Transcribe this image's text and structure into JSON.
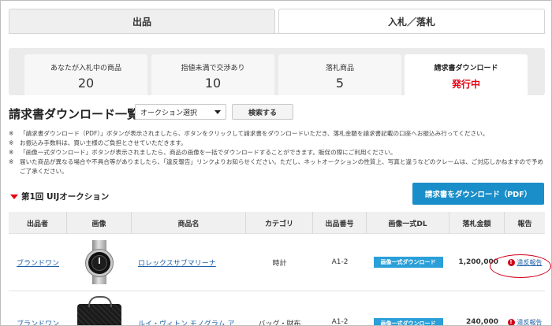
{
  "top_tabs": [
    {
      "label": "出品",
      "active": false
    },
    {
      "label": "入札／落札",
      "active": true
    }
  ],
  "status_cards": [
    {
      "label": "あなたが入札中の商品",
      "value": "20"
    },
    {
      "label": "指値未満で交渉あり",
      "value": "10"
    },
    {
      "label": "落札商品",
      "value": "5"
    },
    {
      "label": "請求書ダウンロード",
      "value": "発行中"
    }
  ],
  "page_title": "請求書ダウンロード一覧",
  "auction_select": {
    "value": "オークション選択"
  },
  "search_label": "検索する",
  "notes": [
    {
      "mark": "※",
      "text": "「請求書ダウンロード（PDF）」ボタンが表示されましたら、ボタンをクリックして請求書をダウンロードいただき、落札金額を請求書記載の口座へお振込み行ってください。"
    },
    {
      "mark": "※",
      "text": "お振込み手数料は、買い主様のご負担とさせていただきます。"
    },
    {
      "mark": "※",
      "text": "「画像一式ダウンロード」ボタンが表示されましたら、商品の画像を一括でダウンロードすることができます。販促の際にご利用ください。"
    },
    {
      "mark": "※",
      "text": "届いた商品が異なる場合や不具合等がありましたら、「違反報告」リンクよりお知らせください。ただし、ネットオークションの性質上、写真と違うなどのクレームは、ご対応しかねますので予めご了承ください。"
    }
  ],
  "auction_title": "第1回 UIJオークション",
  "download_pdf_label": "請求書をダウンロード（PDF）",
  "table": {
    "headers": [
      "出品者",
      "画像",
      "商品名",
      "カテゴリ",
      "出品番号",
      "画像一式DL",
      "落札金額",
      "報告"
    ],
    "rows": [
      {
        "seller": "ブランドワン",
        "image": "watch",
        "name": "ロレックスサブマリーナ",
        "category": "時計",
        "lot": "A1-2",
        "dl_label": "画像一式ダウンロード",
        "price": "1,200,000",
        "report": "違反報告"
      },
      {
        "seller": "ブランドワン",
        "image": "bag",
        "name": "ルイ・ヴィトン モノグラム ア",
        "category": "バッグ・財布",
        "lot": "A1-2",
        "dl_label": "画像一式ダウンロード",
        "price": "240,000",
        "report": "違反報告"
      }
    ]
  },
  "colors": {
    "accent_red": "#e60012",
    "primary_blue": "#1a8ec9",
    "link_blue": "#1b5fa8"
  }
}
